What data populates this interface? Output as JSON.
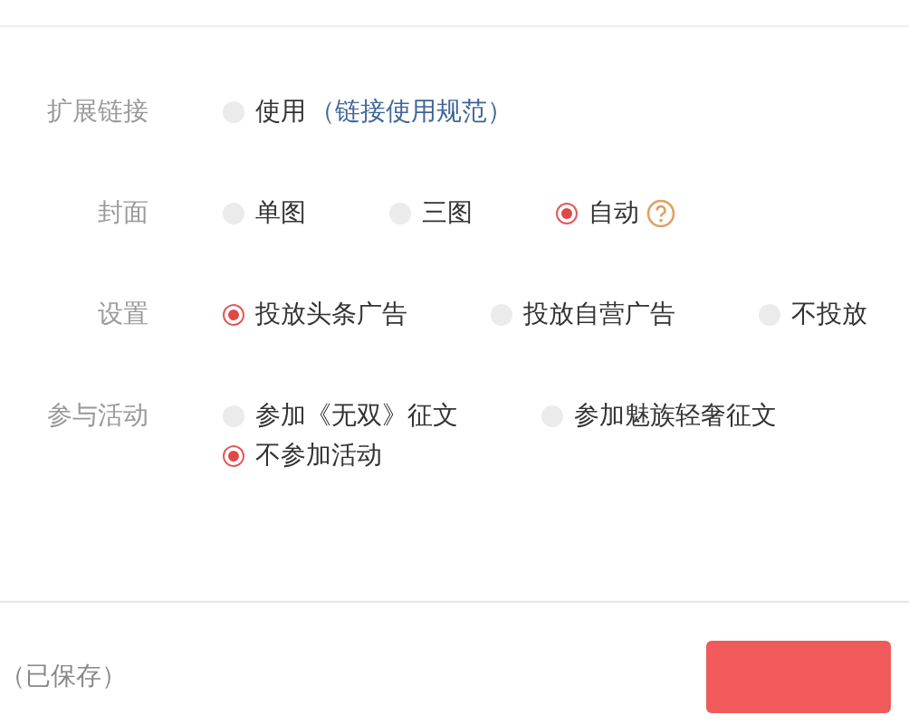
{
  "settings": [
    {
      "label": "扩展链接",
      "options": [
        {
          "label": "使用",
          "selected": false,
          "link": "（链接使用规范）"
        }
      ]
    },
    {
      "label": "封面",
      "options": [
        {
          "label": "单图",
          "selected": false
        },
        {
          "label": "三图",
          "selected": false
        },
        {
          "label": "自动",
          "selected": true,
          "help": true
        }
      ]
    },
    {
      "label": "设置",
      "options": [
        {
          "label": "投放头条广告",
          "selected": true
        },
        {
          "label": "投放自营广告",
          "selected": false
        },
        {
          "label": "不投放",
          "selected": false
        }
      ]
    },
    {
      "label": "参与活动",
      "options": [
        {
          "label": "参加《无双》征文",
          "selected": false
        },
        {
          "label": "参加魅族轻奢征文",
          "selected": false
        },
        {
          "label": "不参加活动",
          "selected": true
        }
      ]
    }
  ],
  "footer": {
    "status": "（已保存）",
    "button": {
      "kind": "primary"
    }
  }
}
